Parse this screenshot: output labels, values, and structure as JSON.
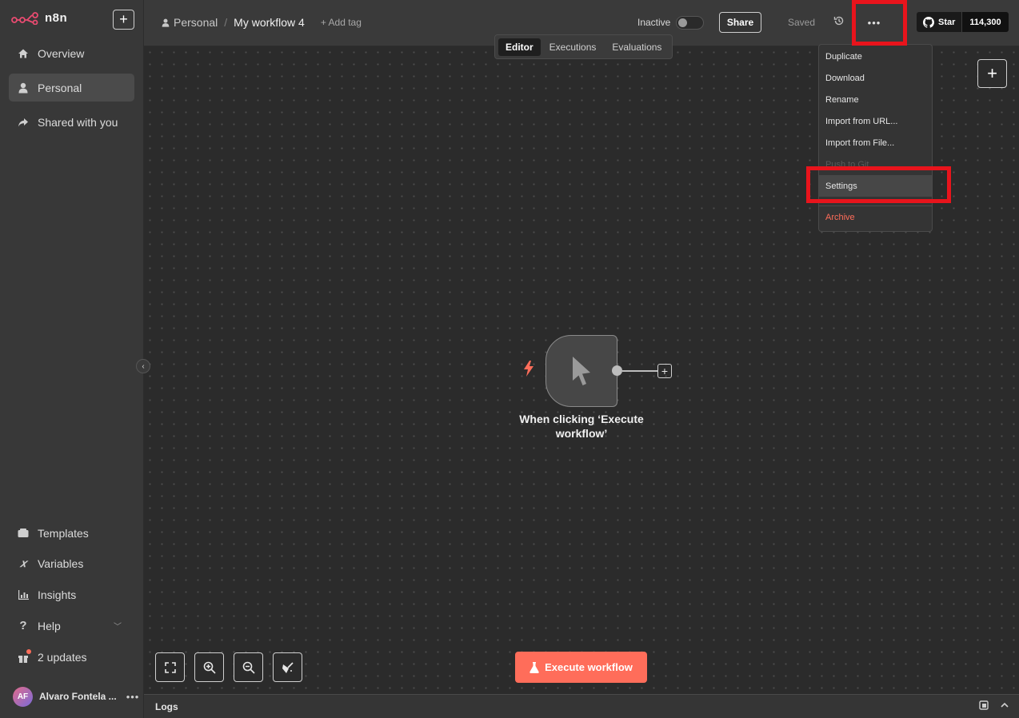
{
  "app": {
    "logo_text": "n8n"
  },
  "sidebar": {
    "top_items": [
      {
        "label": "Overview",
        "icon": "home-icon"
      },
      {
        "label": "Personal",
        "icon": "user-icon",
        "active": true
      },
      {
        "label": "Shared with you",
        "icon": "share-icon"
      }
    ],
    "bottom_items": [
      {
        "label": "Templates",
        "icon": "templates-icon"
      },
      {
        "label": "Variables",
        "icon": "variables-icon"
      },
      {
        "label": "Insights",
        "icon": "insights-icon"
      },
      {
        "label": "Help",
        "icon": "help-icon"
      },
      {
        "label": "2 updates",
        "icon": "gift-icon"
      }
    ],
    "user": {
      "initials": "AF",
      "name": "Alvaro Fontela ..."
    }
  },
  "header": {
    "project": "Personal",
    "separator": "/",
    "workflow_title": "My workflow 4",
    "add_tag": "+ Add tag",
    "status_label": "Inactive",
    "share_label": "Share",
    "saved_label": "Saved",
    "more_label": "•••",
    "github": {
      "star_label": "Star",
      "count": "114,300"
    }
  },
  "tabs": [
    {
      "label": "Editor",
      "active": true
    },
    {
      "label": "Executions"
    },
    {
      "label": "Evaluations"
    }
  ],
  "canvas": {
    "node": {
      "label": "When clicking ‘Execute workflow’"
    },
    "execute_button": "Execute workflow"
  },
  "menu": {
    "items": [
      {
        "label": "Duplicate"
      },
      {
        "label": "Download"
      },
      {
        "label": "Rename"
      },
      {
        "label": "Import from URL..."
      },
      {
        "label": "Import from File..."
      },
      {
        "label": "Push to Git",
        "disabled": true
      },
      {
        "label": "Settings",
        "hover": true
      },
      {
        "label": "Archive",
        "danger": true
      }
    ]
  },
  "logs": {
    "label": "Logs"
  },
  "colors": {
    "accent": "#ff6d5a",
    "highlight": "#e8141c",
    "canvas": "#2b2b2b",
    "sidebar": "#383838"
  }
}
